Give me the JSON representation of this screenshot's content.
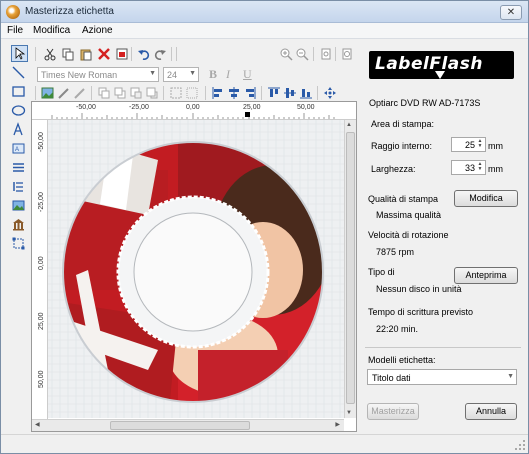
{
  "window": {
    "title": "Masterizza etichetta",
    "close_glyph": "✕"
  },
  "menu": {
    "items": [
      "File",
      "Modifica",
      "Azione"
    ]
  },
  "toolbar": {
    "font_name": "Times New Roman",
    "font_size": "24",
    "bold": "B",
    "italic": "I",
    "underline": "U",
    "delete_color": "#d42020"
  },
  "ruler": {
    "h_labels": [
      "-50,00",
      "-25,00",
      "0,00",
      "25,00",
      "50,00"
    ],
    "v_labels": [
      "-50,00",
      "-25,00",
      "0,00",
      "25,00",
      "50,00"
    ]
  },
  "right_panel": {
    "logo": "LabelFlash",
    "drive": "Optiarc DVD RW AD-7173S",
    "print_area_heading": "Area di stampa:",
    "inner_radius_label": "Raggio interno:",
    "inner_radius_value": "25",
    "inner_radius_unit": "mm",
    "width_label": "Larghezza:",
    "width_value": "33",
    "width_unit": "mm",
    "quality_heading": "Qualità di stampa",
    "quality_value": "Massima qualità",
    "modify_button": "Modifica",
    "speed_heading": "Velocità di rotazione",
    "speed_value": "7875 rpm",
    "disc_type_heading": "Tipo di",
    "disc_type_value": "Nessun disco in unità",
    "preview_button": "Anteprima",
    "time_heading": "Tempo di scrittura previsto",
    "time_value": "22:20 min.",
    "template_heading": "Modelli etichetta:",
    "template_value": "Titolo dati",
    "burn_button": "Masterizza",
    "cancel_button": "Annulla"
  }
}
